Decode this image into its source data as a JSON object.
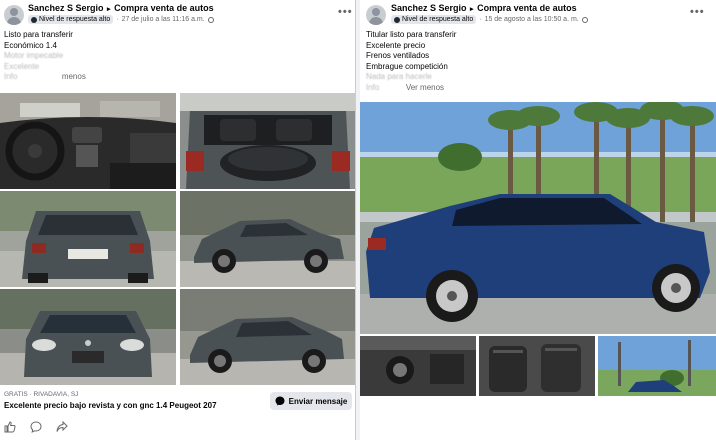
{
  "post1": {
    "author": "Sanchez S Sergio",
    "arrow": "▸",
    "group": "Compra venta de autos",
    "badge": "Nivel de respuesta alto",
    "sep": "·",
    "date": "27 de julio a las 11:16 a.m.",
    "lines": [
      "Listo para transferir",
      "Económico 1.4",
      "Motor impecable",
      "Excelente"
    ],
    "more_prefix": "Info",
    "more_label": "menos",
    "price": "GRATIS · RIVADAVIA, SJ",
    "ad_title": "Excelente precio bajo revista y con gnc 1.4 Peugeot 207",
    "send_label": "Enviar mensaje",
    "car_color": "#4a5155"
  },
  "post2": {
    "author": "Sanchez S Sergio",
    "arrow": "▸",
    "group": "Compra venta de autos",
    "badge": "Nivel de respuesta alto",
    "sep": "·",
    "date": "15 de agosto a las 10:50 a. m.",
    "lines": [
      "Titular listo para transferir",
      "Excelente precio",
      "Frenos ventilados",
      "Embrague competición",
      "Nada para hacerle"
    ],
    "more_prefix": "Info",
    "more_label": "Ver menos",
    "car_color": "#1f3f7a"
  },
  "icons": {
    "options": "more-options-icon",
    "like": "like-icon",
    "comment": "comment-icon",
    "share": "share-icon",
    "messenger": "messenger-icon"
  }
}
